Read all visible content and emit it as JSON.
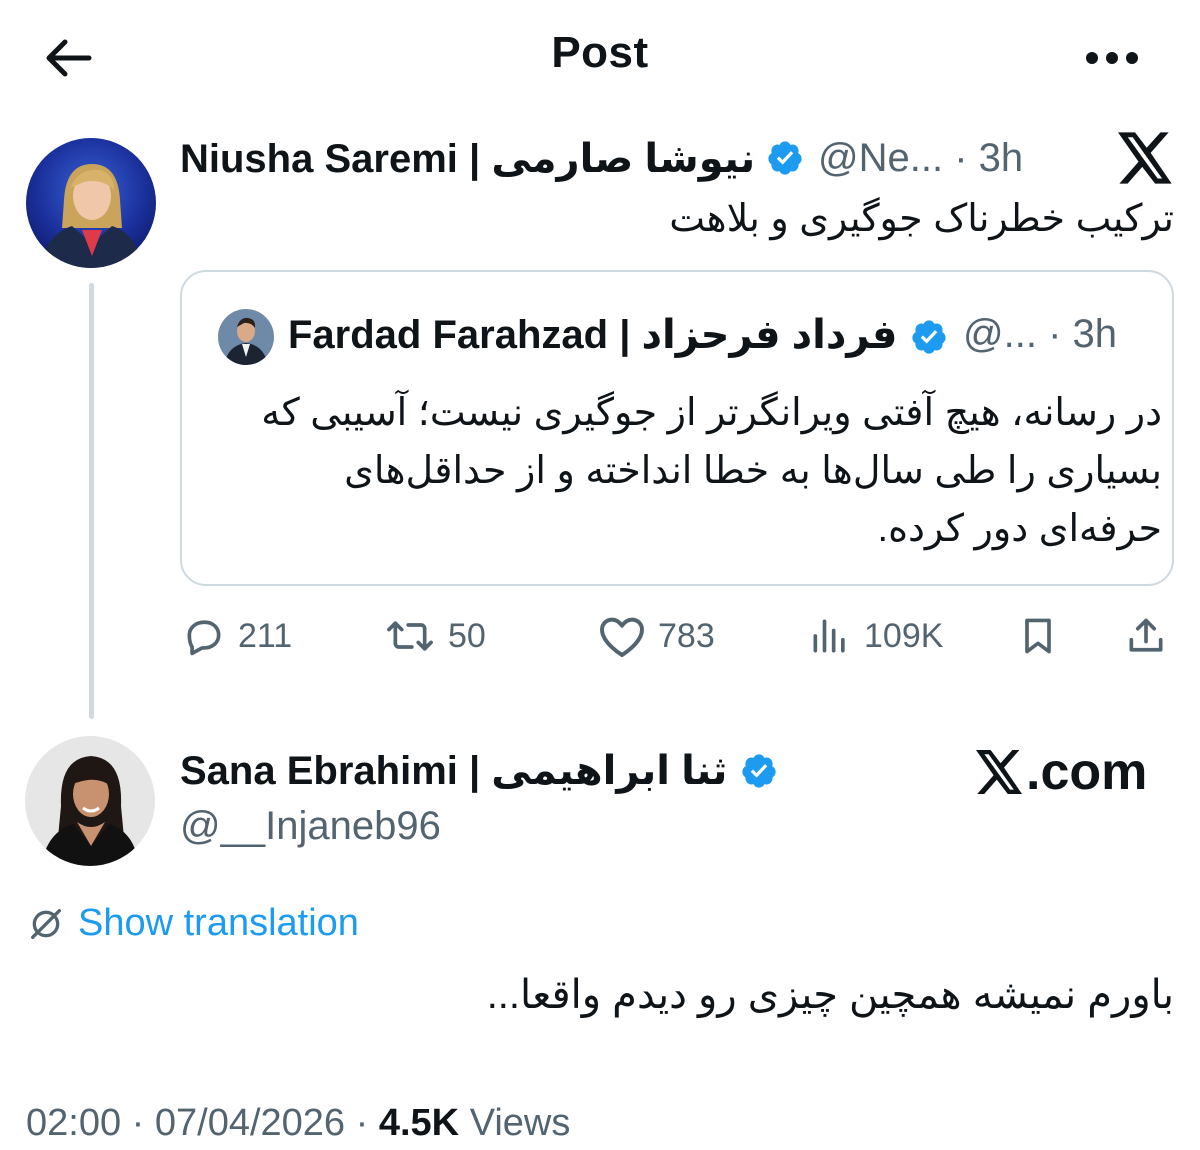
{
  "header": {
    "title": "Post",
    "back_icon": "arrow-left-icon",
    "more_icon": "ellipsis-icon"
  },
  "colors": {
    "accent_blue": "#1d9bf0",
    "secondary_text": "#536471",
    "border": "#cfd9de",
    "primary_text": "#0f1419"
  },
  "quoting_post": {
    "author_name": "Niusha Saremi | نیوشا صارمی",
    "verified": true,
    "handle": "@Ne...",
    "time": "3h",
    "text": "ترکیب خطرناک جوگیری و بلاهت",
    "quoted_post": {
      "author_name": "Fardad Farahzad | فرداد فرحزاد",
      "verified": true,
      "handle": "@...",
      "time": "3h",
      "text": "در رسانه، هیچ آفتی ویرانگرتر از جوگیری نیست؛ آسیبی که بسیاری را طی سال‌ها به خطا انداخته و از حداقل‌های حرفه‌ای دور کرده."
    },
    "stats": {
      "replies": "211",
      "reposts": "50",
      "likes": "783",
      "views": "109K"
    }
  },
  "main_post": {
    "author_name": "Sana Ebrahimi | ثنا ابراهیمی",
    "verified": true,
    "handle": "@__Injaneb96",
    "watermark": ".com",
    "translate_label": "Show translation",
    "text": "باورم نمیشه همچین چیزی رو دیدم واقعا...",
    "time": "02:00",
    "date": "07/04/2026",
    "views_count": "4.5K",
    "views_label": "Views"
  }
}
